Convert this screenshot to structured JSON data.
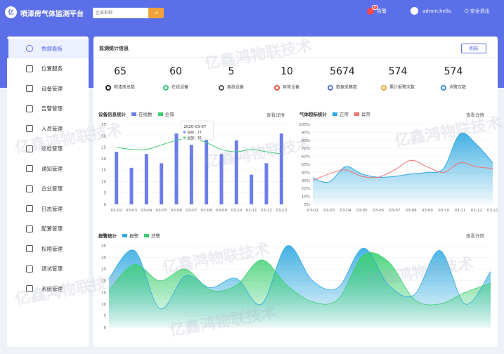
{
  "header": {
    "logo_text": "亿",
    "title": "喷漆房气体监测平台",
    "search_placeholder": "企业名称",
    "search_button": "→",
    "alarm_label": "告警",
    "alarm_count": "0",
    "username": "admin,hello",
    "logout_label": "安全退出",
    "accent_color": "#5b70e8"
  },
  "sidebar": {
    "items": [
      {
        "label": "数据看板",
        "icon": "dashboard-icon"
      },
      {
        "label": "位置服务",
        "icon": "location-icon"
      },
      {
        "label": "设备管理",
        "icon": "device-icon"
      },
      {
        "label": "告警管理",
        "icon": "alert-icon"
      },
      {
        "label": "人员管理",
        "icon": "user-icon"
      },
      {
        "label": "巡检管理",
        "icon": "history-icon"
      },
      {
        "label": "通知管理",
        "icon": "mail-icon"
      },
      {
        "label": "企业管理",
        "icon": "home-icon"
      },
      {
        "label": "日志管理",
        "icon": "log-icon"
      },
      {
        "label": "配置管理",
        "icon": "settings-icon"
      },
      {
        "label": "权限管理",
        "icon": "lock-icon"
      },
      {
        "label": "调试管理",
        "icon": "flask-icon"
      },
      {
        "label": "系统管理",
        "icon": "globe-icon"
      }
    ]
  },
  "overview": {
    "title": "监测统计信息",
    "refresh_label": "刷新",
    "stats": [
      {
        "value": "65",
        "label": "喷漆房总数",
        "color": "#222222"
      },
      {
        "value": "60",
        "label": "在线设备",
        "color": "#2ecc71"
      },
      {
        "value": "5",
        "label": "离线设备",
        "color": "#555555"
      },
      {
        "value": "10",
        "label": "异常设备",
        "color": "#e74c3c"
      },
      {
        "value": "5674",
        "label": "数据采集数",
        "color": "#5b70e8"
      },
      {
        "value": "574",
        "label": "累计报警次数",
        "color": "#f0a23a"
      },
      {
        "value": "574",
        "label": "消警次数",
        "color": "#3a8ee6"
      }
    ]
  },
  "device_chart": {
    "title": "设备信息统计",
    "legend": [
      "在线数",
      "全部"
    ],
    "view_detail": "查看详情",
    "tooltip": {
      "date": "2020-03-07",
      "online": "在线：27",
      "all": "全部：35"
    }
  },
  "gas_chart": {
    "title": "气体超标统计",
    "legend": [
      "正常",
      "异常"
    ],
    "view_detail": "查看详情"
  },
  "alarm_chart": {
    "title": "报警统计",
    "legend": [
      "报警",
      "消警"
    ],
    "view_detail": "查看详情"
  },
  "watermark": "亿鑫鸿物联技术",
  "chart_data": [
    {
      "type": "bar",
      "title": "设备信息统计",
      "categories": [
        "03-02",
        "03-03",
        "03-04",
        "03-05",
        "03-06",
        "03-07",
        "03-08",
        "03-09",
        "03-10",
        "03-11",
        "03-12",
        "03-13"
      ],
      "series": [
        {
          "name": "在线数",
          "type": "bar",
          "color": "#6c7ee8",
          "values": [
            23,
            16,
            22,
            18,
            31,
            26,
            30,
            22,
            28,
            13,
            18,
            31
          ]
        },
        {
          "name": "全部",
          "type": "line",
          "color": "#3ccf70",
          "values": [
            25,
            24,
            24,
            26,
            28,
            29,
            27,
            24,
            23,
            24,
            23,
            22
          ]
        }
      ],
      "ylim": [
        0,
        35
      ],
      "yticks": [
        0,
        5,
        10,
        15,
        20,
        25,
        30,
        35
      ]
    },
    {
      "type": "area",
      "title": "气体超标统计",
      "categories": [
        "03-02",
        "03-03",
        "03-04",
        "03-05",
        "03-06",
        "03-07",
        "03-08",
        "03-09",
        "03-10",
        "03-11",
        "03-12",
        "03-13"
      ],
      "series": [
        {
          "name": "正常",
          "color": "#2ea8e0",
          "values": [
            33,
            28,
            47,
            38,
            34,
            35,
            38,
            40,
            45,
            88,
            75,
            52
          ]
        },
        {
          "name": "异常",
          "color": "#f07070",
          "values": [
            30,
            38,
            43,
            35,
            34,
            43,
            55,
            47,
            40,
            52,
            47,
            45
          ]
        }
      ],
      "ylim": [
        0,
        100
      ],
      "yticks": [
        "0%",
        "10%",
        "20%",
        "30%",
        "40%",
        "50%",
        "60%",
        "70%",
        "80%",
        "90%",
        "100%"
      ]
    },
    {
      "type": "area",
      "title": "报警统计",
      "series": [
        {
          "name": "报警",
          "color": "#2ea8e0",
          "values": [
            21,
            33,
            8,
            22,
            17,
            21,
            10,
            35,
            20,
            17,
            34,
            18,
            14,
            33,
            10,
            24
          ]
        },
        {
          "name": "消警",
          "color": "#3ccf70",
          "values": [
            16,
            27,
            20,
            25,
            16,
            18,
            29,
            18,
            11,
            12,
            31,
            28,
            12,
            10,
            15,
            19
          ]
        }
      ],
      "ylim": [
        0,
        35
      ],
      "yticks": [
        0,
        5,
        10,
        15,
        20,
        25,
        30,
        35
      ]
    }
  ]
}
